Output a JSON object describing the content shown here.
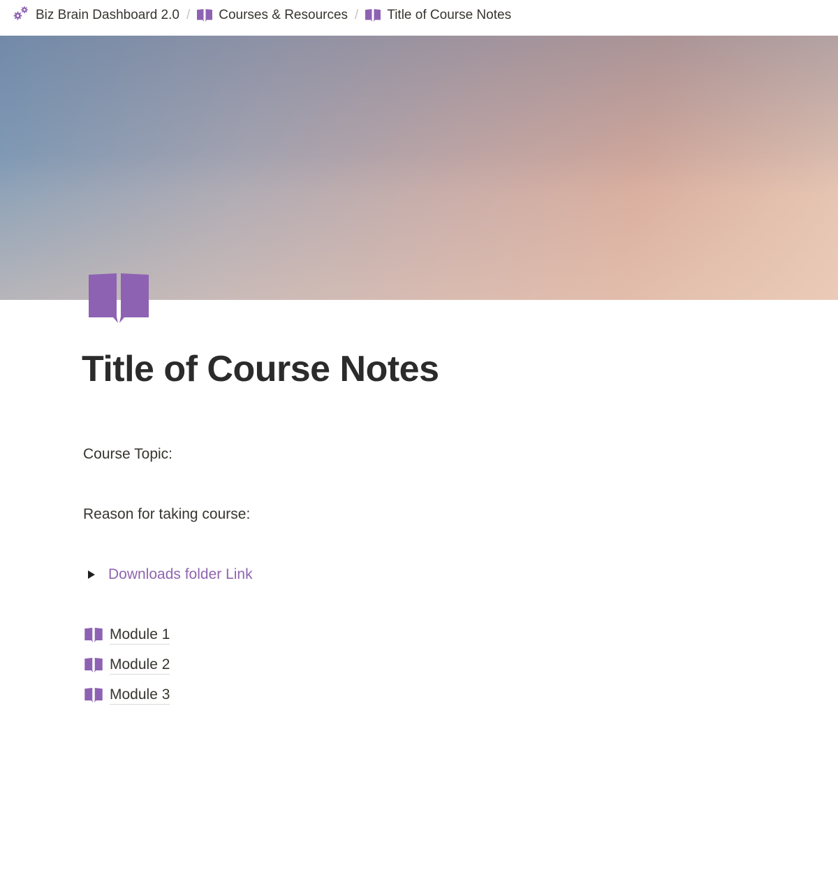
{
  "breadcrumb": [
    {
      "label": "Biz Brain Dashboard 2.0",
      "icon": "gears-icon"
    },
    {
      "label": "Courses & Resources",
      "icon": "book-icon"
    },
    {
      "label": "Title of Course Notes",
      "icon": "book-icon"
    }
  ],
  "breadcrumb_separator": "/",
  "page": {
    "title": "Title of Course Notes",
    "icon": "book-icon",
    "course_topic_label": "Course Topic:",
    "reason_label": "Reason for taking course:",
    "toggle_link": "Downloads folder Link",
    "modules": [
      "Module 1",
      "Module 2",
      "Module 3"
    ]
  },
  "colors": {
    "accent": "#9065b0",
    "text": "#37352f"
  }
}
